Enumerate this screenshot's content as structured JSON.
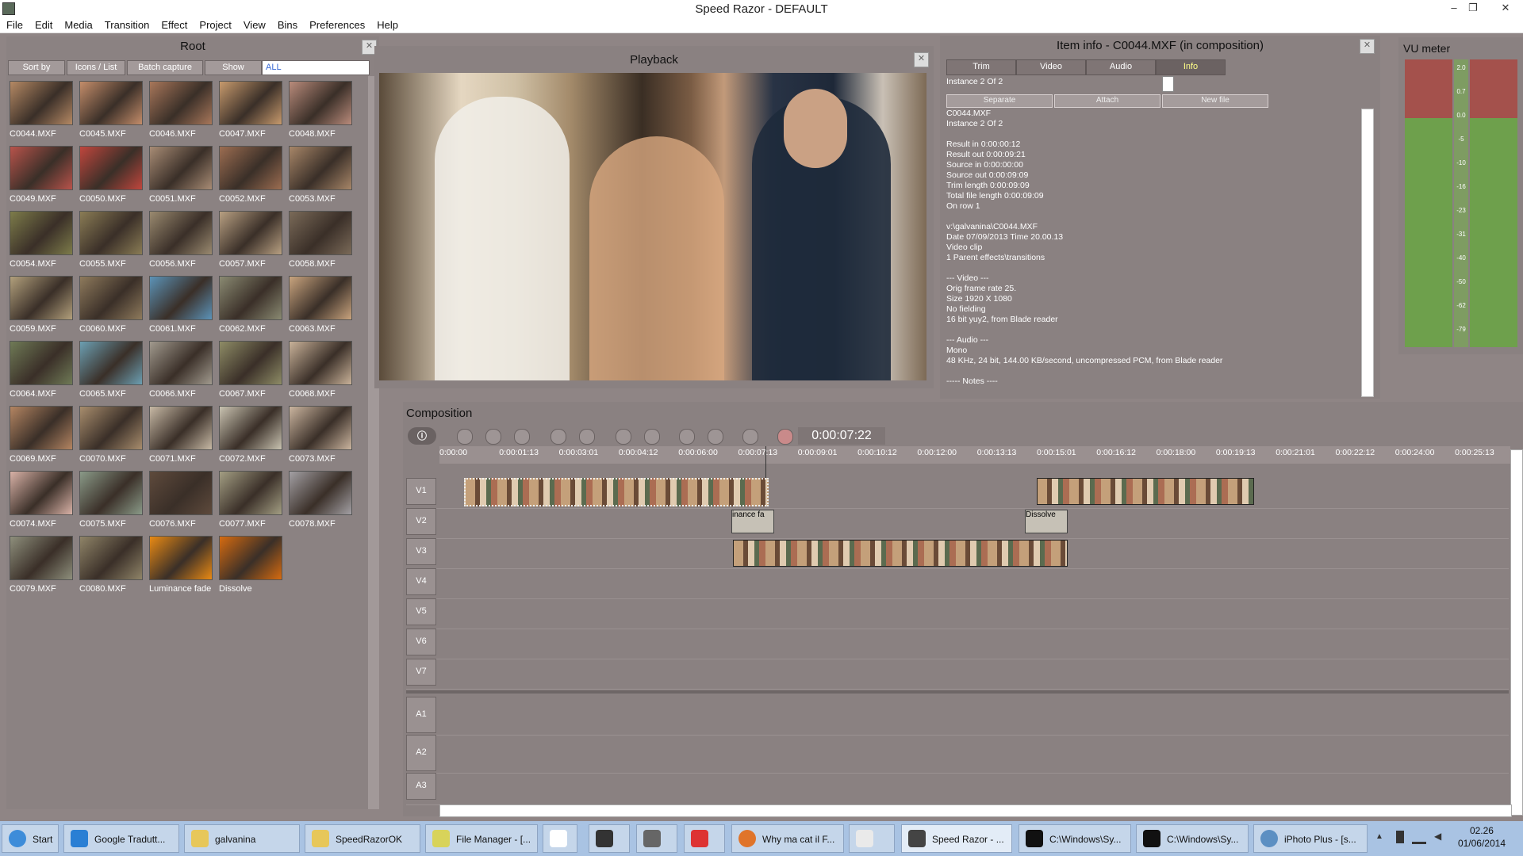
{
  "window": {
    "title": "Speed Razor - DEFAULT"
  },
  "menu": [
    "File",
    "Edit",
    "Media",
    "Transition",
    "Effect",
    "Project",
    "View",
    "Bins",
    "Preferences",
    "Help"
  ],
  "root": {
    "title": "Root",
    "buttons": [
      "Sort by",
      "Icons / List",
      "Batch capture",
      "Show"
    ],
    "filter": "ALL",
    "thumbs": [
      {
        "label": "C0044.MXF",
        "color": "#b58964"
      },
      {
        "label": "C0045.MXF",
        "color": "#c48d6a"
      },
      {
        "label": "C0046.MXF",
        "color": "#a8775a"
      },
      {
        "label": "C0047.MXF",
        "color": "#c79a6d"
      },
      {
        "label": "C0048.MXF",
        "color": "#b98b7b"
      },
      {
        "label": "C0049.MXF",
        "color": "#b8534b"
      },
      {
        "label": "C0050.MXF",
        "color": "#c0463d"
      },
      {
        "label": "C0051.MXF",
        "color": "#a88c75"
      },
      {
        "label": "C0052.MXF",
        "color": "#9c6d51"
      },
      {
        "label": "C0053.MXF",
        "color": "#a78668"
      },
      {
        "label": "C0054.MXF",
        "color": "#7d7c4a"
      },
      {
        "label": "C0055.MXF",
        "color": "#8a7c55"
      },
      {
        "label": "C0056.MXF",
        "color": "#9a8a70"
      },
      {
        "label": "C0057.MXF",
        "color": "#b8a082"
      },
      {
        "label": "C0058.MXF",
        "color": "#7a6a58"
      },
      {
        "label": "C0059.MXF",
        "color": "#b2a07c"
      },
      {
        "label": "C0060.MXF",
        "color": "#8e7a5c"
      },
      {
        "label": "C0061.MXF",
        "color": "#5c93b8"
      },
      {
        "label": "C0062.MXF",
        "color": "#8a8a72"
      },
      {
        "label": "C0063.MXF",
        "color": "#c9a47e"
      },
      {
        "label": "C0064.MXF",
        "color": "#6f7a56"
      },
      {
        "label": "C0065.MXF",
        "color": "#6c9fb2"
      },
      {
        "label": "C0066.MXF",
        "color": "#a19a8e"
      },
      {
        "label": "C0067.MXF",
        "color": "#8e8c66"
      },
      {
        "label": "C0068.MXF",
        "color": "#c9b299"
      },
      {
        "label": "C0069.MXF",
        "color": "#b48562"
      },
      {
        "label": "C0070.MXF",
        "color": "#a88d6d"
      },
      {
        "label": "C0071.MXF",
        "color": "#c7b9a5"
      },
      {
        "label": "C0072.MXF",
        "color": "#c9c3b1"
      },
      {
        "label": "C0073.MXF",
        "color": "#cbb59f"
      },
      {
        "label": "C0074.MXF",
        "color": "#d9b2a7"
      },
      {
        "label": "C0075.MXF",
        "color": "#8a9a88"
      },
      {
        "label": "C0076.MXF",
        "color": "#5e4a3c"
      },
      {
        "label": "C0077.MXF",
        "color": "#a39e83"
      },
      {
        "label": "C0078.MXF",
        "color": "#a3a0a4"
      },
      {
        "label": "C0079.MXF",
        "color": "#8e8f7c"
      },
      {
        "label": "C0080.MXF",
        "color": "#8f8468"
      },
      {
        "label": "Luminance fade",
        "color": "#e98a14"
      },
      {
        "label": "Dissolve",
        "color": "#d66b10"
      }
    ]
  },
  "playback": {
    "title": "Playback"
  },
  "iteminfo": {
    "title": "Item info - C0044.MXF (in composition)",
    "tabs": [
      "Trim",
      "Video",
      "Audio",
      "Info"
    ],
    "instance": "Instance 2 Of 2",
    "buttons": [
      "Separate",
      "Attach",
      "New file"
    ],
    "text": "C0044.MXF\nInstance 2 Of 2\n\nResult in 0:00:00:12\nResult out 0:00:09:21\nSource in 0:00:00:00\nSource out 0:00:09:09\nTrim length 0:00:09:09\nTotal file length 0:00:09:09\nOn row 1\n\nv:\\galvanina\\C0044.MXF\nDate 07/09/2013 Time 20.00.13\nVideo clip\n1 Parent effects\\transitions\n\n--- Video ---\nOrig frame rate 25.\nSize 1920 X 1080\nNo fielding\n16 bit yuy2, from Blade reader\n\n--- Audio ---\nMono\n48 KHz, 24 bit, 144.00 KB/second, uncompressed PCM, from Blade reader\n\n----- Notes ----"
  },
  "vu": {
    "title": "VU meter",
    "scale": [
      "2.0",
      "0.7",
      "0.0",
      "-5",
      "-10",
      "-16",
      "-23",
      "-31",
      "-40",
      "-50",
      "-62",
      "-79"
    ]
  },
  "composition": {
    "title": "Composition",
    "timecode": "0:00:07:22",
    "ruler": [
      "0:00:00",
      "0:00:01:13",
      "0:00:03:01",
      "0:00:04:12",
      "0:00:06:00",
      "0:00:07:13",
      "0:00:09:01",
      "0:00:10:12",
      "0:00:12:00",
      "0:00:13:13",
      "0:00:15:01",
      "0:00:16:12",
      "0:00:18:00",
      "0:00:19:13",
      "0:00:21:01",
      "0:00:22:12",
      "0:00:24:00",
      "0:00:25:13"
    ],
    "video_tracks": [
      "V1",
      "V2",
      "V3",
      "V4",
      "V5",
      "V6",
      "V7"
    ],
    "audio_tracks": [
      "A1",
      "A2",
      "A3"
    ],
    "transitions": [
      "inance fa",
      "Dissolve"
    ]
  },
  "taskbar": {
    "start": "Start",
    "items": [
      "Google Tradutt...",
      "galvanina",
      "SpeedRazorOK",
      "File Manager - [...",
      "Why ma cat il F...",
      "Speed Razor - ...",
      "C:\\Windows\\Sy...",
      "C:\\Windows\\Sy...",
      "iPhoto Plus - [s..."
    ],
    "time": "02.26",
    "date": "01/06/2014"
  }
}
